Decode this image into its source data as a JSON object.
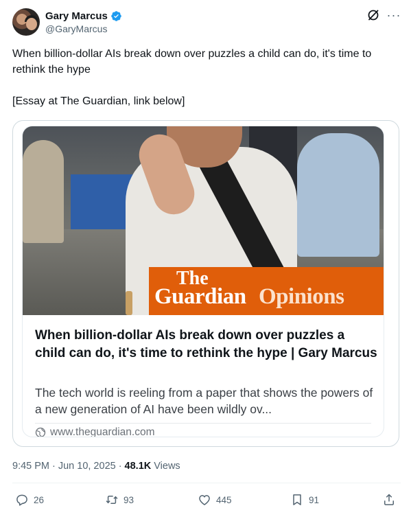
{
  "author": {
    "display_name": "Gary Marcus",
    "handle": "@GaryMarcus",
    "verified": true,
    "avatar_icon": "avatar-photo"
  },
  "header_actions": {
    "grok_icon": "grok-icon",
    "more_icon": "more-icon",
    "more_label": "···"
  },
  "tweet": {
    "text": "When billion-dollar AIs break down over puzzles a child can do, it's time to rethink the hype\n\n[Essay at The Guardian, link below]"
  },
  "card": {
    "brand_the": "The",
    "brand_guardian": "Guardian",
    "brand_opinions": "Opinions",
    "title": "When billion-dollar AIs break down over puzzles a child can do, it's time to rethink the hype | Gary Marcus",
    "description": "The tech world is reeling from a paper that shows the powers of a new generation of AI have been wildly ov...",
    "domain": "www.theguardian.com",
    "brand_color": "#e05e0a"
  },
  "meta": {
    "time": "9:45 PM",
    "separator": "·",
    "date": "Jun 10, 2025",
    "views_count": "48.1K",
    "views_label": "Views"
  },
  "actions": {
    "reply_count": "26",
    "repost_count": "93",
    "like_count": "445",
    "bookmark_count": "91"
  },
  "colors": {
    "text_primary": "#0f1419",
    "text_secondary": "#536471",
    "verified_blue": "#1d9bf0",
    "border": "#cfd9de"
  }
}
